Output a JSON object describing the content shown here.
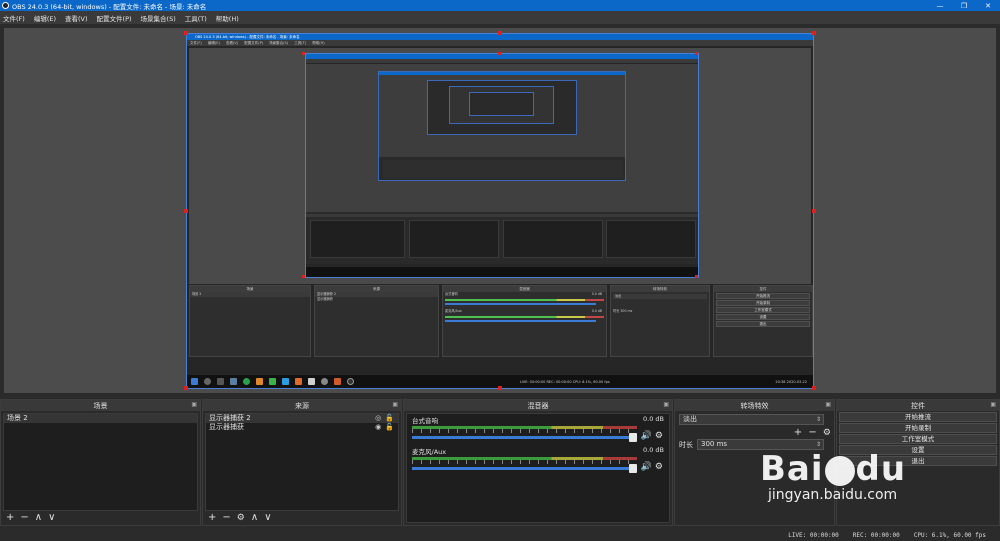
{
  "window": {
    "title": "OBS 24.0.3 (64-bit, windows) - 配置文件: 未命名 - 场景: 未命名",
    "controls": [
      "—",
      "❐",
      "✕"
    ]
  },
  "menu": [
    "文件(F)",
    "编辑(E)",
    "查看(V)",
    "配置文件(P)",
    "场景集合(S)",
    "工具(T)",
    "帮助(H)"
  ],
  "scenes": {
    "title": "场景",
    "items": [
      "场景 2"
    ],
    "toolbar": [
      "+",
      "−",
      "∧",
      "∨"
    ]
  },
  "sources": {
    "title": "来源",
    "items": [
      {
        "name": "显示器捕获 2",
        "icons": [
          "eye-slash-icon",
          "lock-icon"
        ]
      },
      {
        "name": "显示器捕获",
        "icons": [
          "eye-icon",
          "lock-icon"
        ]
      }
    ],
    "toolbar": [
      "+",
      "−",
      "⚙",
      "∧",
      "∨"
    ]
  },
  "mixer": {
    "title": "混音器",
    "channels": [
      {
        "name": "台式音响",
        "level": "0.0 dB"
      },
      {
        "name": "麦克风/Aux",
        "level": "0.0 dB"
      }
    ]
  },
  "transitions": {
    "title": "转场特效",
    "selected": "淡出",
    "duration_label": "时长",
    "duration_value": "300 ms"
  },
  "controls": {
    "title": "控件",
    "buttons": [
      "开始推流",
      "开始录制",
      "工作室模式",
      "设置",
      "退出"
    ]
  },
  "status": {
    "live": "LIVE: 00:00:00",
    "rec": "REC: 00:00:00",
    "cpu": "CPU: 6.1%, 60.00 fps"
  },
  "inner": {
    "title": "OBS 24.0.3 (64-bit, windows) - 配置文件: 未命名 - 场景: 未命名",
    "menu": [
      "文件(F)",
      "编辑(E)",
      "查看(V)",
      "配置文件(P)",
      "场景集合(S)",
      "工具(T)",
      "帮助(H)"
    ],
    "scene": "场景 2",
    "sources": [
      "显示器捕获 2",
      "显示器捕获"
    ],
    "mixer": [
      "台式音响",
      "麦克风/Aux"
    ],
    "db": "0.0 dB",
    "transition": "淡出",
    "duration": "300 ms",
    "duration_label": "时长",
    "panels": [
      "场景",
      "来源",
      "混音器",
      "转场特效",
      "控件"
    ],
    "buttons": [
      "开始推流",
      "开始录制",
      "工作室模式",
      "设置",
      "退出"
    ],
    "status": "LIVE: 00:00:00   REC: 00:00:00   CPU: 6.1%, 60.00 fps",
    "clock": "20:38",
    "date": "2020-03-22"
  },
  "watermark": {
    "brand": "Bai du",
    "url": "jingyan.baidu.com"
  }
}
